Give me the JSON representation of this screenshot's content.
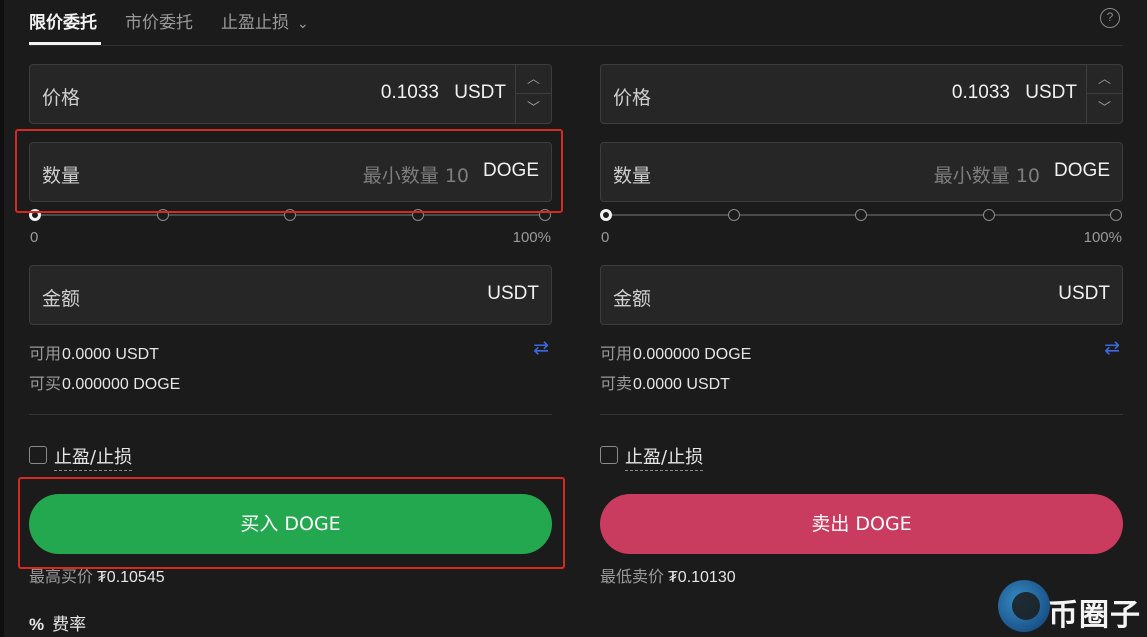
{
  "tabs": {
    "limit": "限价委托",
    "market": "市价委托",
    "stop": "止盈止损"
  },
  "buy": {
    "price_label": "价格",
    "price_value": "0.1033",
    "price_unit": "USDT",
    "qty_label": "数量",
    "qty_placeholder": "最小数量 10",
    "qty_unit": "DOGE",
    "slider_min": "0",
    "slider_max": "100%",
    "amount_label": "金额",
    "amount_unit": "USDT",
    "available_label": "可用",
    "available_value": "0.0000 USDT",
    "can_buy_label": "可买",
    "can_buy_value": "0.000000 DOGE",
    "tpsl_label": "止盈/止损",
    "button_label": "买入 DOGE",
    "best_label": "最高买价",
    "best_value": "₮0.10545"
  },
  "sell": {
    "price_label": "价格",
    "price_value": "0.1033",
    "price_unit": "USDT",
    "qty_label": "数量",
    "qty_placeholder": "最小数量 10",
    "qty_unit": "DOGE",
    "slider_min": "0",
    "slider_max": "100%",
    "amount_label": "金额",
    "amount_unit": "USDT",
    "available_label": "可用",
    "available_value": "0.000000 DOGE",
    "can_sell_label": "可卖",
    "can_sell_value": "0.0000 USDT",
    "tpsl_label": "止盈/止损",
    "button_label": "卖出 DOGE",
    "best_label": "最低卖价",
    "best_value": "₮0.10130"
  },
  "fee": {
    "icon": "%",
    "label": "费率"
  },
  "icons": {
    "help": "?",
    "chevron": "⌄",
    "step_up": "︿",
    "step_down": "﹀",
    "swap": "⇄"
  },
  "watermark": {
    "text": "币圈子"
  },
  "colors": {
    "background": "#1b1b1b",
    "buy": "#24a84f",
    "sell": "#c93b5f",
    "accent": "#3e6ae0",
    "highlight": "#d42a22"
  },
  "slider_level": 0
}
